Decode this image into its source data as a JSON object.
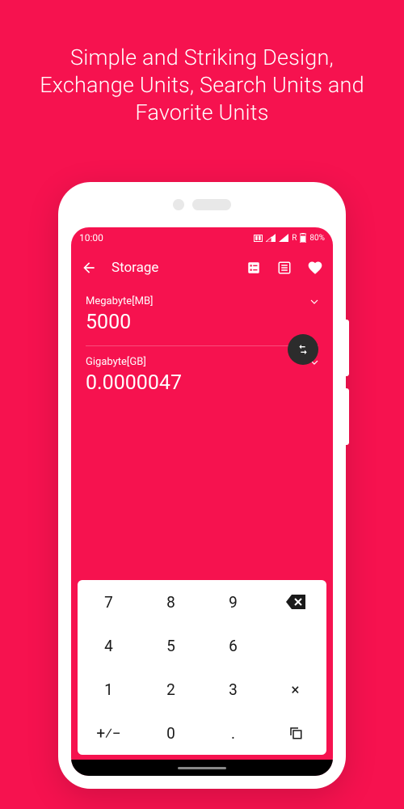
{
  "headline": "Simple and Striking Design, Exchange Units, Search Units and Favorite Units",
  "status": {
    "time": "10:00",
    "roaming": "R",
    "battery": "80%"
  },
  "appbar": {
    "title": "Storage"
  },
  "converter": {
    "from_unit": "Megabyte[MB]",
    "from_value": "5000",
    "to_unit": "Gigabyte[GB]",
    "to_value": "0.0000047"
  },
  "keypad": {
    "k7": "7",
    "k8": "8",
    "k9": "9",
    "k4": "4",
    "k5": "5",
    "k6": "6",
    "k1": "1",
    "k2": "2",
    "k3": "3",
    "k0": "0",
    "kdot": ".",
    "ksign": "+⁄−",
    "kmul": "×"
  }
}
